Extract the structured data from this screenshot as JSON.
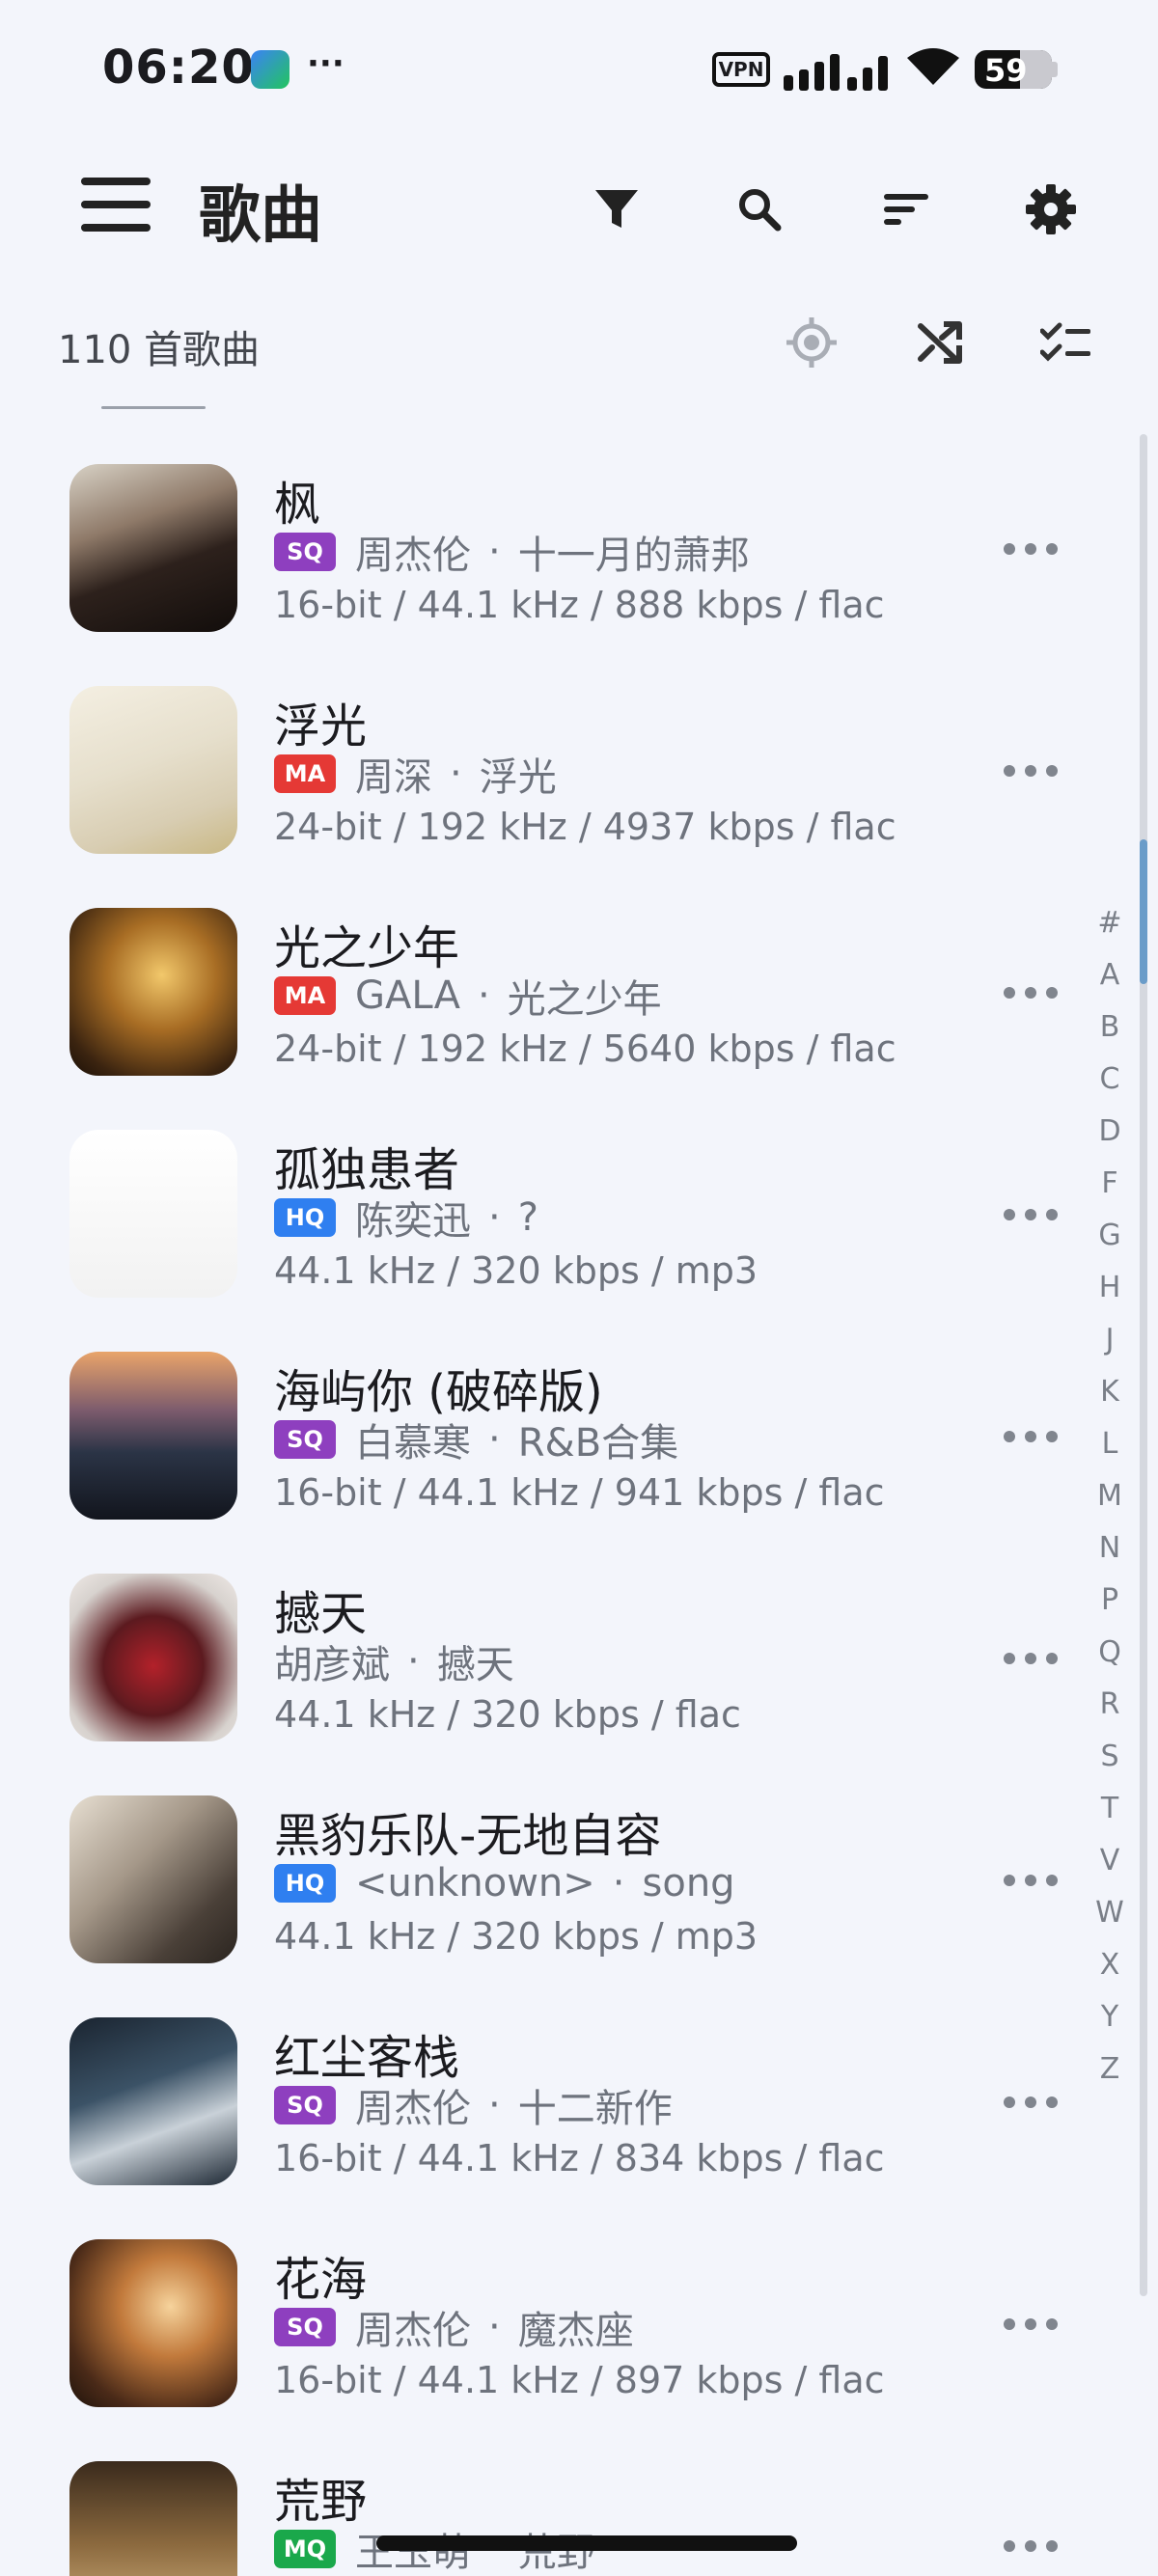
{
  "status_bar": {
    "time": "06:20",
    "notification_more": "···",
    "vpn_label": "VPN",
    "battery_level": "59",
    "battery_fraction": 0.59
  },
  "toolbar": {
    "title": "歌曲",
    "icons": [
      "menu-icon",
      "filter-icon",
      "search-icon",
      "sort-icon",
      "settings-icon"
    ]
  },
  "subheader": {
    "song_count": "110 首歌曲",
    "icons": [
      "locate-icon",
      "shuffle-icon",
      "multiselect-icon"
    ]
  },
  "colors": {
    "background": "#f3f5fb",
    "badge_sq": "#8e3fbf",
    "badge_ma": "#e53935",
    "badge_hq": "#2f7ff0",
    "badge_mq": "#1aa84b",
    "scroll_thumb": "#6a9cc9"
  },
  "songs": [
    {
      "title": "枫",
      "badge": "SQ",
      "artist": "周杰伦",
      "separator": "·",
      "album": "十一月的萧邦",
      "format": "16-bit / 44.1 kHz / 888 kbps / flac"
    },
    {
      "title": "浮光",
      "badge": "MA",
      "artist": "周深",
      "separator": "·",
      "album": "浮光",
      "format": "24-bit / 192 kHz / 4937 kbps / flac"
    },
    {
      "title": "光之少年",
      "badge": "MA",
      "artist": "GALA",
      "separator": "·",
      "album": "光之少年",
      "format": "24-bit / 192 kHz / 5640 kbps / flac"
    },
    {
      "title": "孤独患者",
      "badge": "HQ",
      "artist": "陈奕迅",
      "separator": "·",
      "album": "?",
      "format": "44.1 kHz / 320 kbps / mp3"
    },
    {
      "title": "海屿你 (破碎版)",
      "badge": "SQ",
      "artist": "白慕寒",
      "separator": "·",
      "album": "R&B合集",
      "format": "16-bit / 44.1 kHz / 941 kbps / flac"
    },
    {
      "title": "撼天",
      "badge": "",
      "artist": "胡彦斌",
      "separator": "·",
      "album": "撼天",
      "format": "44.1 kHz / 320 kbps / flac"
    },
    {
      "title": "黑豹乐队-无地自容",
      "badge": "HQ",
      "artist": "<unknown>",
      "separator": "·",
      "album": "song",
      "format": "44.1 kHz / 320 kbps / mp3"
    },
    {
      "title": "红尘客栈",
      "badge": "SQ",
      "artist": "周杰伦",
      "separator": "·",
      "album": "十二新作",
      "format": "16-bit / 44.1 kHz / 834 kbps / flac"
    },
    {
      "title": "花海",
      "badge": "SQ",
      "artist": "周杰伦",
      "separator": "·",
      "album": "魔杰座",
      "format": "16-bit / 44.1 kHz / 897 kbps / flac"
    },
    {
      "title": "荒野",
      "badge": "MQ",
      "artist": "王玉萌",
      "separator": "·",
      "album": "荒野",
      "format": ""
    }
  ],
  "alphabet_index": [
    "#",
    "A",
    "B",
    "C",
    "D",
    "F",
    "G",
    "H",
    "J",
    "K",
    "L",
    "M",
    "N",
    "P",
    "Q",
    "R",
    "S",
    "T",
    "V",
    "W",
    "X",
    "Y",
    "Z"
  ]
}
